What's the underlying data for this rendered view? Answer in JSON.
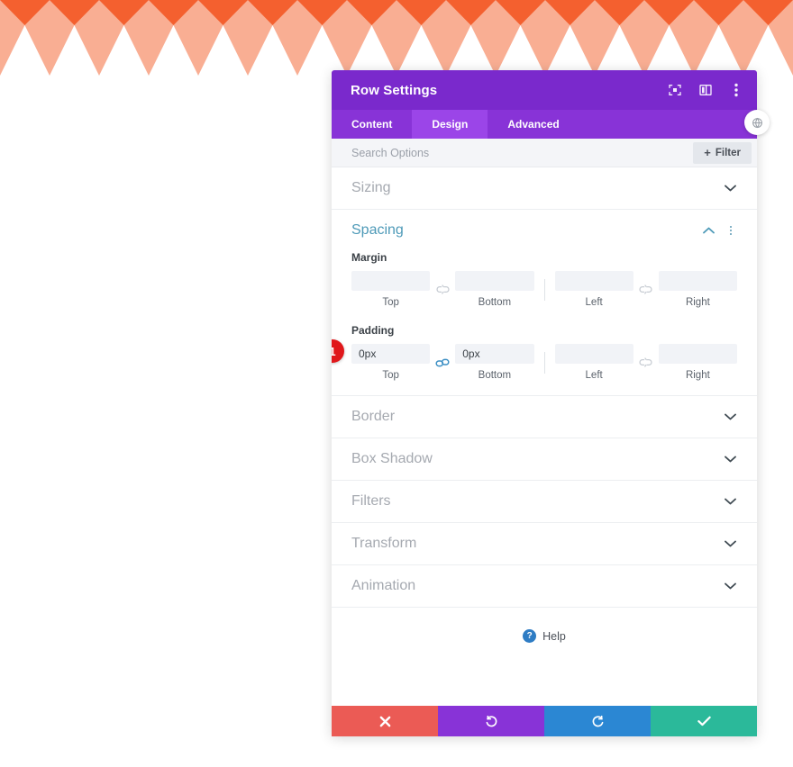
{
  "background": {
    "name": "diamond-chevron-pattern",
    "color_dark": "#F4602F",
    "color_light": "#F9AE93",
    "color_white": "#FFFFFF"
  },
  "modal": {
    "title": "Row Settings",
    "header_icons": [
      {
        "name": "focus-icon",
        "label": "Focus"
      },
      {
        "name": "layout-panel-icon",
        "label": "Layout"
      },
      {
        "name": "more-vertical-icon",
        "label": "More Options"
      }
    ],
    "edge_handle": {
      "name": "drag-handle-icon",
      "label": "Move"
    },
    "tabs": [
      {
        "id": "content",
        "label": "Content",
        "active": false
      },
      {
        "id": "design",
        "label": "Design",
        "active": true
      },
      {
        "id": "advanced",
        "label": "Advanced",
        "active": false
      }
    ],
    "search": {
      "placeholder": "Search Options",
      "value": ""
    },
    "filter_button": {
      "label": "Filter",
      "plus": "+"
    },
    "sections": [
      {
        "id": "sizing",
        "title": "Sizing",
        "open": false
      },
      {
        "id": "spacing",
        "title": "Spacing",
        "open": true
      },
      {
        "id": "border",
        "title": "Border",
        "open": false
      },
      {
        "id": "box-shadow",
        "title": "Box Shadow",
        "open": false
      },
      {
        "id": "filters",
        "title": "Filters",
        "open": false
      },
      {
        "id": "transform",
        "title": "Transform",
        "open": false
      },
      {
        "id": "animation",
        "title": "Animation",
        "open": false
      }
    ],
    "spacing": {
      "margin": {
        "label": "Margin",
        "linked_vertical": false,
        "linked_horizontal": false,
        "fields": [
          {
            "id": "margin-top",
            "caption": "Top",
            "value": "",
            "placeholder": ""
          },
          {
            "id": "margin-bottom",
            "caption": "Bottom",
            "value": "",
            "placeholder": ""
          },
          {
            "id": "margin-left",
            "caption": "Left",
            "value": "",
            "placeholder": ""
          },
          {
            "id": "margin-right",
            "caption": "Right",
            "value": "",
            "placeholder": ""
          }
        ]
      },
      "padding": {
        "label": "Padding",
        "linked_vertical": true,
        "linked_horizontal": false,
        "badge": "1",
        "fields": [
          {
            "id": "padding-top",
            "caption": "Top",
            "value": "0px",
            "placeholder": ""
          },
          {
            "id": "padding-bottom",
            "caption": "Bottom",
            "value": "0px",
            "placeholder": ""
          },
          {
            "id": "padding-left",
            "caption": "Left",
            "value": "",
            "placeholder": ""
          },
          {
            "id": "padding-right",
            "caption": "Right",
            "value": "",
            "placeholder": ""
          }
        ]
      }
    },
    "help": {
      "icon_glyph": "?",
      "label": "Help"
    },
    "actions": [
      {
        "id": "cancel",
        "name": "cancel-button",
        "icon": "close-icon",
        "color": "#EB5B55"
      },
      {
        "id": "undo",
        "name": "undo-button",
        "icon": "undo-icon",
        "color": "#8833D7"
      },
      {
        "id": "redo",
        "name": "redo-button",
        "icon": "redo-icon",
        "color": "#2B87D3"
      },
      {
        "id": "save",
        "name": "save-button",
        "icon": "check-icon",
        "color": "#2BB99A"
      }
    ]
  },
  "colors": {
    "header_purple": "#7A29CC",
    "tab_purple": "#8833D7",
    "tab_active_purple": "#9B45E8",
    "accent_teal": "#4E9AB8",
    "badge_red": "#E0181B",
    "help_blue": "#2E7CC4",
    "link_active_blue": "#3C8FC4"
  }
}
